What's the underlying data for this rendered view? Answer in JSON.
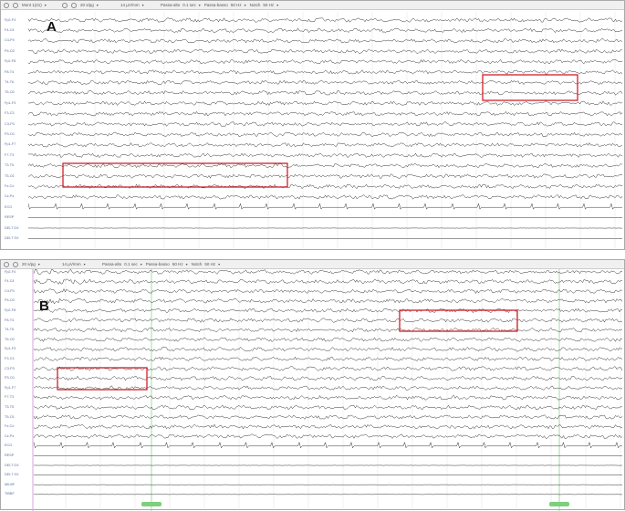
{
  "panel_a": {
    "letter": "A",
    "toolbar": {
      "montage": "Mont 1(21)",
      "sensitivity": "20 s/pg",
      "speed": "14 µV/mm",
      "highpass_label": "Passa-alto",
      "highpass": "0.1 sec",
      "lowpass_label": "Passa-basso",
      "lowpass": "50 Hz",
      "notch_label": "Notch",
      "notch": "50 Hz"
    },
    "channels": [
      "Fp2-F4",
      "F4-C4",
      "C4-P4",
      "P4-O2",
      "Fp2-F8",
      "F8-T4",
      "T4-T6",
      "T6-O2",
      "Fp1-F3",
      "F3-C3",
      "C3-P3",
      "P3-O1",
      "Fp1-F7",
      "F7-T3",
      "T3-T5",
      "T5-O1",
      "Fz-Cz",
      "Cz-Pz",
      "ECG",
      "RESP",
      "DELT DX",
      "DELT SX"
    ]
  },
  "panel_b": {
    "letter": "B",
    "toolbar": {
      "sensitivity": "20 s/pg",
      "speed": "14 µV/mm",
      "highpass_label": "Passa-alto",
      "highpass": "0.1 sec",
      "lowpass_label": "Passa-basso",
      "lowpass": "50 Hz",
      "notch_label": "Notch",
      "notch": "50 Hz"
    },
    "channels": [
      "Fp2-F4",
      "F4-C4",
      "C4-P4",
      "P4-O2",
      "Fp2-F8",
      "F8-T4",
      "T4-T6",
      "T6-O2",
      "Fp1-F3",
      "F3-C3",
      "C3-P3",
      "P3-O1",
      "Fp1-F7",
      "F7-T3",
      "T3-T5",
      "T5-O1",
      "Fz-Cz",
      "Cz-Pz",
      "ECG",
      "RESP",
      "DELT DX",
      "DELT SX",
      "MILBF",
      "TIBBF"
    ]
  },
  "colors": {
    "highlight": "#d0202a",
    "trace": "#333333",
    "marker": "#7ccf7c",
    "label": "#5a6f9c"
  }
}
